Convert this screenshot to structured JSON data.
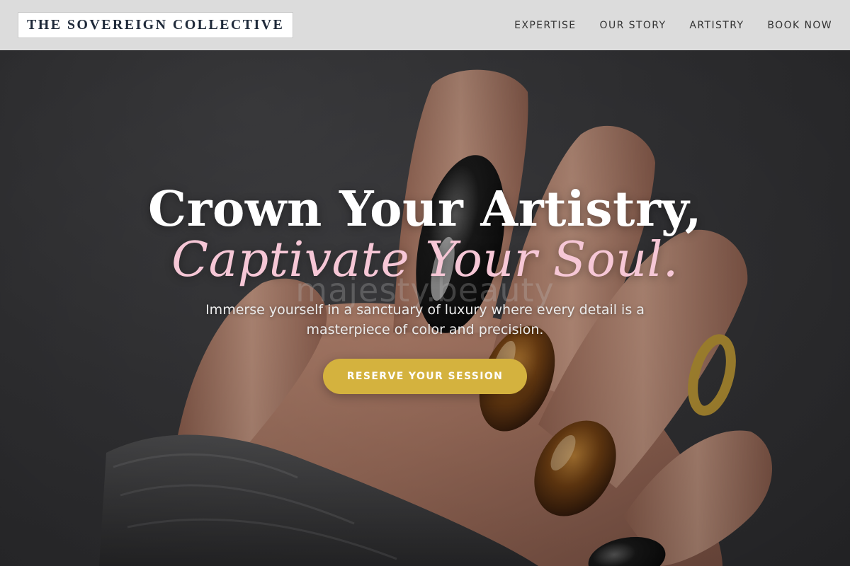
{
  "brand": {
    "name": "THE SOVEREIGN COLLECTIVE"
  },
  "nav": {
    "items": [
      {
        "label": "EXPERTISE"
      },
      {
        "label": "OUR STORY"
      },
      {
        "label": "ARTISTRY"
      },
      {
        "label": "BOOK NOW"
      }
    ]
  },
  "hero": {
    "headline": "Crown Your Artistry,",
    "headline_accent": "Captivate Your Soul.",
    "watermark": "majesty.beauty",
    "subtitle": "Immerse yourself in a sanctuary of luxury where every detail is a masterpiece of color and precision.",
    "cta_label": "RESERVE YOUR SESSION",
    "image": "hand-with-tortoiseshell-nails"
  },
  "colors": {
    "header_bg": "#dcdcdc",
    "brand_text": "#1f2a3a",
    "accent_pink": "#f6c7d6",
    "cta_gold": "#d4b23e",
    "hero_bg": "#3a3a3c"
  }
}
